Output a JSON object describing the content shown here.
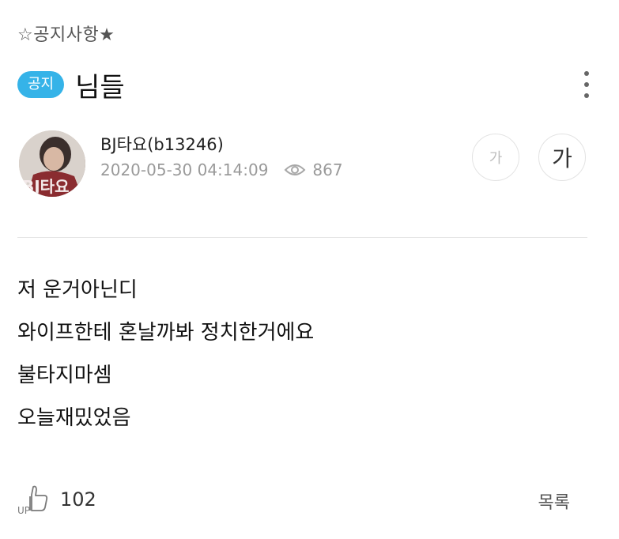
{
  "category": {
    "label": "☆공지사항★"
  },
  "post": {
    "badge": "공지",
    "title": "님들",
    "more_icon": "more-vertical-icon"
  },
  "author": {
    "name": "BJ타요(b13246)",
    "date": "2020-05-30 04:14:09",
    "views": "867",
    "views_icon": "eye-icon",
    "avatar_text": "BJ타요"
  },
  "font_controls": {
    "small_label": "가",
    "large_label": "가"
  },
  "content": {
    "lines": [
      "저 운거아닌디",
      "와이프한테 혼날까봐 정치한거에요",
      "불타지마셈",
      "오늘재밌었음"
    ]
  },
  "footer": {
    "like_icon": "thumbs-up-icon",
    "like_count": "102",
    "list_label": "목록"
  },
  "colors": {
    "badge": "#35b3e8",
    "muted": "#9a9a9a",
    "text": "#111111"
  }
}
